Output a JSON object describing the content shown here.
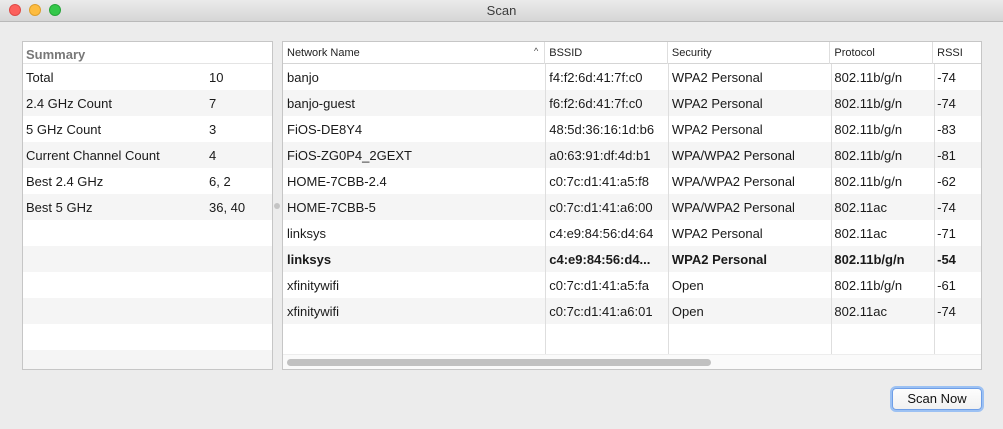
{
  "window": {
    "title": "Scan"
  },
  "summary": {
    "header": "Summary",
    "rows": [
      {
        "label": "Total",
        "value": "10"
      },
      {
        "label": "2.4 GHz Count",
        "value": "7"
      },
      {
        "label": "5 GHz Count",
        "value": "3"
      },
      {
        "label": "Current Channel Count",
        "value": "4"
      },
      {
        "label": "Best 2.4 GHz",
        "value": "6, 2"
      },
      {
        "label": "Best 5 GHz",
        "value": "36, 40"
      }
    ]
  },
  "table": {
    "columns": [
      "Network Name",
      "BSSID",
      "Security",
      "Protocol",
      "RSSI"
    ],
    "sort_indicator": "^",
    "rows": [
      [
        "banjo",
        "f4:f2:6d:41:7f:c0",
        "WPA2 Personal",
        "802.11b/g/n",
        "-74"
      ],
      [
        "banjo-guest",
        "f6:f2:6d:41:7f:c0",
        "WPA2 Personal",
        "802.11b/g/n",
        "-74"
      ],
      [
        "FiOS-DE8Y4",
        "48:5d:36:16:1d:b6",
        "WPA2 Personal",
        "802.11b/g/n",
        "-83"
      ],
      [
        "FiOS-ZG0P4_2GEXT",
        "a0:63:91:df:4d:b1",
        "WPA/WPA2 Personal",
        "802.11b/g/n",
        "-81"
      ],
      [
        "HOME-7CBB-2.4",
        "c0:7c:d1:41:a5:f8",
        "WPA/WPA2 Personal",
        "802.11b/g/n",
        "-62"
      ],
      [
        "HOME-7CBB-5",
        "c0:7c:d1:41:a6:00",
        "WPA/WPA2 Personal",
        "802.11ac",
        "-74"
      ],
      [
        "linksys",
        "c4:e9:84:56:d4:64",
        "WPA2 Personal",
        "802.11ac",
        "-71"
      ],
      [
        "linksys",
        "c4:e9:84:56:d4...",
        "WPA2 Personal",
        "802.11b/g/n",
        "-54"
      ],
      [
        "xfinitywifi",
        "c0:7c:d1:41:a5:fa",
        "Open",
        "802.11b/g/n",
        "-61"
      ],
      [
        "xfinitywifi",
        "c0:7c:d1:41:a6:01",
        "Open",
        "802.11ac",
        "-74"
      ]
    ],
    "bold_row_index": 7
  },
  "actions": {
    "scan_now": "Scan Now"
  },
  "colors": {
    "accent": "#6e9ee7",
    "alt_row": "#f5f5f5"
  }
}
